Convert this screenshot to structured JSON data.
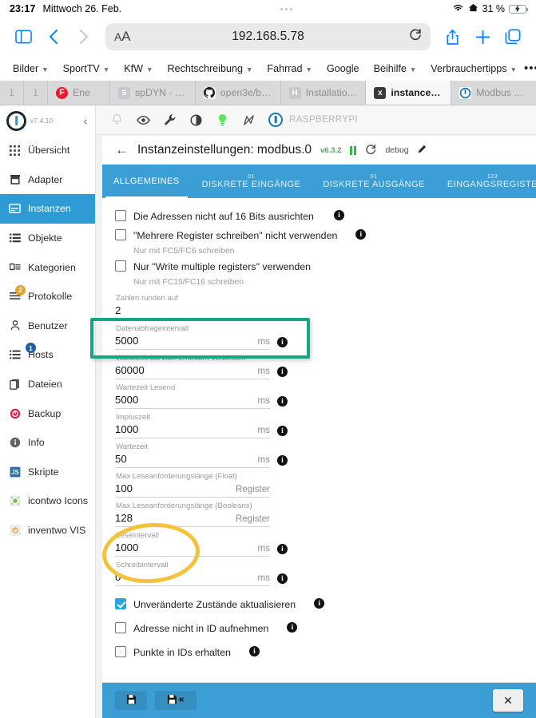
{
  "status_bar": {
    "time": "23:17",
    "date": "Mittwoch 26. Feb.",
    "battery_percent": "31 %",
    "wifi_icon": "wifi-icon",
    "home_icon": "home-icon",
    "battery_icon": "battery-charging-icon"
  },
  "browser": {
    "sidebar_icon": "sidebar-toggle-icon",
    "back_icon": "chevron-left-icon",
    "forward_icon": "chevron-right-icon",
    "text_size_label": "AA",
    "url": "192.168.5.78",
    "reload_icon": "reload-icon",
    "share_icon": "share-icon",
    "new_tab_icon": "plus-icon",
    "tabs_overview_icon": "tabs-icon",
    "favorites": [
      {
        "label": "Bilder",
        "has_chevron": true
      },
      {
        "label": "SportTV",
        "has_chevron": true
      },
      {
        "label": "KfW",
        "has_chevron": true
      },
      {
        "label": "Rechtschreibung",
        "has_chevron": true
      },
      {
        "label": "Fahrrad",
        "has_chevron": true
      },
      {
        "label": "Google",
        "has_chevron": false
      },
      {
        "label": "Beihilfe",
        "has_chevron": true
      },
      {
        "label": "Verbrauchertipps",
        "has_chevron": true
      }
    ],
    "favorites_more": "•••",
    "tabs": [
      {
        "label": "",
        "favicon": "1",
        "active": false,
        "tiny": true
      },
      {
        "label": "",
        "favicon": "1",
        "active": false,
        "tiny": true
      },
      {
        "label": "Ene",
        "favicon": "E",
        "active": false
      },
      {
        "label": "spDYN - der...",
        "favicon": "S",
        "active": false
      },
      {
        "label": "open3e/best...",
        "favicon": "O",
        "active": false
      },
      {
        "label": "Installation -...",
        "favicon": "H",
        "active": false
      },
      {
        "label": "instances - r...",
        "favicon": "x",
        "active": true
      },
      {
        "label": "Modbus & Fr...",
        "favicon": "i",
        "active": false
      }
    ]
  },
  "sidebar": {
    "version": "v7.4.10",
    "collapse_icon": "chevron-left-icon",
    "items": [
      {
        "label": "Übersicht",
        "icon": "grid-icon",
        "selected": false,
        "badge": null
      },
      {
        "label": "Adapter",
        "icon": "store-icon",
        "selected": false,
        "badge": null
      },
      {
        "label": "Instanzen",
        "icon": "instances-icon",
        "selected": true,
        "badge": null
      },
      {
        "label": "Objekte",
        "icon": "list-icon",
        "selected": false,
        "badge": null
      },
      {
        "label": "Kategorien",
        "icon": "category-icon",
        "selected": false,
        "badge": null
      },
      {
        "label": "Protokolle",
        "icon": "logs-icon",
        "selected": false,
        "badge": "2",
        "badge_color": "orange"
      },
      {
        "label": "Benutzer",
        "icon": "user-icon",
        "selected": false,
        "badge": null
      },
      {
        "label": "Hosts",
        "icon": "hosts-icon",
        "selected": false,
        "badge": "1",
        "badge_color": "blue"
      },
      {
        "label": "Dateien",
        "icon": "files-icon",
        "selected": false,
        "badge": null
      },
      {
        "label": "Backup",
        "icon": "backup-icon",
        "selected": false,
        "badge": null
      },
      {
        "label": "Info",
        "icon": "info-icon",
        "selected": false,
        "badge": null
      },
      {
        "label": "Skripte",
        "icon": "script-js-icon",
        "selected": false,
        "badge": null
      },
      {
        "label": "icontwo Icons",
        "icon": "icontwo-icon",
        "selected": false,
        "badge": null
      },
      {
        "label": "inventwo VIS",
        "icon": "inventwo-icon",
        "selected": false,
        "badge": null
      }
    ]
  },
  "app_toolbar": {
    "icons": [
      "bell-icon",
      "eye-icon",
      "wrench-icon",
      "contrast-icon",
      "bulb-icon",
      "no-connection-icon"
    ],
    "host_label": "RASPBERRYPI",
    "host_logo_icon": "iobroker-logo-icon"
  },
  "dialog": {
    "back_icon": "arrow-left-icon",
    "title": "Instanzeinstellungen: modbus.0",
    "version": "v6.3.2",
    "pause_icon": "pause-icon",
    "restart_icon": "restart-icon",
    "log_level": "debug",
    "edit_icon": "pencil-icon",
    "tabs": [
      {
        "sup": "",
        "label": "ALLGEMEINES",
        "active": true
      },
      {
        "sup": "01",
        "label": "DISKRETE EINGÄNGE",
        "active": false
      },
      {
        "sup": "01",
        "label": "DISKRETE AUSGÄNGE",
        "active": false
      },
      {
        "sup": "123",
        "label": "EINGANGSREGISTE",
        "active": false
      }
    ],
    "tabs_next_icon": "chevron-right-icon",
    "checkboxes_top": [
      {
        "label": "Die Adressen nicht auf 16 Bits ausrichten",
        "help": "",
        "checked": false,
        "info": true
      },
      {
        "label": "\"Mehrere Register schreiben\" nicht verwenden",
        "help": "Nur mit FC5/FC6 schreiben",
        "checked": false,
        "info": true
      },
      {
        "label": "Nur \"Write multiple registers\" verwenden",
        "help": "Nur mit FC15/FC16 schreiben",
        "checked": false,
        "info": false
      }
    ],
    "fields": [
      {
        "label": "Zahlen runden auf",
        "value": "2",
        "unit": "",
        "info": false
      },
      {
        "label": "Datenabfrageintervall",
        "value": "5000",
        "unit": "ms",
        "info": true
      },
      {
        "label": "Wartezeit bis zum erneuten Verbinden",
        "value": "60000",
        "unit": "ms",
        "info": true
      },
      {
        "label": "Wartezeit Lesend",
        "value": "5000",
        "unit": "ms",
        "info": true
      },
      {
        "label": "Impluszeit",
        "value": "1000",
        "unit": "ms",
        "info": true
      },
      {
        "label": "Wartezeit",
        "value": "50",
        "unit": "ms",
        "info": true
      },
      {
        "label": "Max Leseanforderungslänge (Float)",
        "value": "100",
        "unit": "Register",
        "info": false
      },
      {
        "label": "Max Leseanforderungslänge (Booleans)",
        "value": "128",
        "unit": "Register",
        "info": false
      },
      {
        "label": "Leseintervall",
        "value": "1000",
        "unit": "ms",
        "info": true
      },
      {
        "label": "Schreibintervall",
        "value": "0",
        "unit": "ms",
        "info": true
      }
    ],
    "checkboxes_bottom": [
      {
        "label": "Unveränderte Zustände aktualisieren",
        "checked": true,
        "info": true
      },
      {
        "label": "Adresse nicht in ID aufnehmen",
        "checked": false,
        "info": true
      },
      {
        "label": "Punkte in IDs erhalten",
        "checked": false,
        "info": true
      }
    ],
    "footer": {
      "save_icon": "save-icon",
      "save_close_icon": "save-and-close-icon",
      "close_label": "✕"
    }
  },
  "annotations": {
    "highlight_rect_color": "#13a783",
    "highlight_rect_target": "Datenabfrageintervall",
    "highlight_ellipse_color": "#f5c23b",
    "highlight_ellipse_target": "Leseintervall / Schreibintervall"
  }
}
